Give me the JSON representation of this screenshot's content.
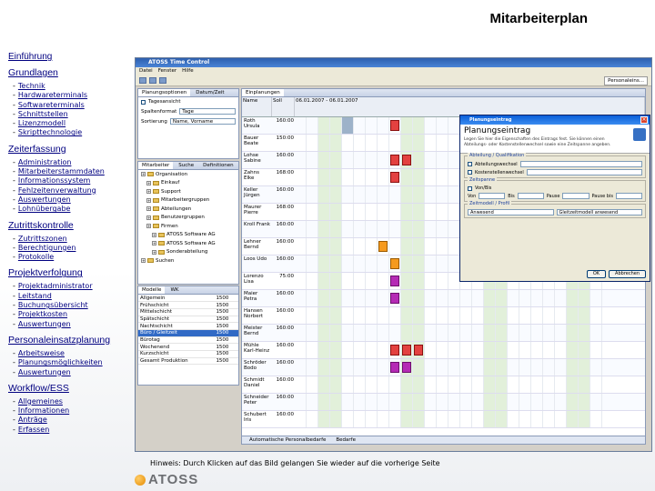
{
  "page": {
    "title": "Mitarbeiterplan",
    "hint": "Hinweis: Durch Klicken auf das Bild gelangen Sie wieder auf die vorherige Seite",
    "logo": "ATOSS"
  },
  "nav": {
    "intro": "Einführung",
    "sections": [
      {
        "title": "Grundlagen",
        "items": [
          "Technik",
          "Hardwareterminals",
          "Softwareterminals",
          "Schnittstellen",
          "Lizenzmodell",
          "Skripttechnologie"
        ]
      },
      {
        "title": "Zeiterfassung",
        "items": [
          "Administration",
          "Mitarbeiterstammdaten",
          "Informationssystem",
          "Fehlzeitenverwaltung",
          "Auswertungen",
          "Lohnübergabe"
        ]
      },
      {
        "title": "Zutrittskontrolle",
        "items": [
          "Zutrittszonen",
          "Berechtigungen",
          "Protokolle"
        ]
      },
      {
        "title": "Projektverfolgung",
        "items": [
          "Projektadministrator",
          "Leitstand",
          "Buchungsübersicht",
          "Projektkosten",
          "Auswertungen"
        ]
      },
      {
        "title": "Personaleinsatzplanung",
        "items": [
          "Arbeitsweise",
          "Planungsmöglichkeiten",
          "Auswertungen"
        ]
      },
      {
        "title": "Workflow/ESS",
        "items": [
          "Allgemeines",
          "Informationen",
          "Anträge",
          "Erfassen"
        ]
      }
    ]
  },
  "app": {
    "title": "ATOSS Time Control",
    "menu": [
      "Datei",
      "Fenster",
      "Hilfe"
    ],
    "perspective": "Personaleins...",
    "options_pane": {
      "tabs": [
        "Planungsoptionen",
        "Datum/Zeit"
      ],
      "tagesansicht": "Tagesansicht",
      "zeitraum_label": "Spaltenformat",
      "zeitraum_value": "Tage",
      "sort_label": "Sortierung",
      "sort_value": "Name, Vorname"
    },
    "tree_pane": {
      "tabs": [
        "Mitarbeiter",
        "Suche",
        "Definitionen"
      ],
      "items": [
        "Organisation",
        "Einkauf",
        "Support",
        "Mitarbeitergruppen",
        "Abteilungen",
        "Benutzergruppen",
        "Firmen",
        "ATOSS Software AG",
        "ATOSS Software AG",
        "Sonderabteilung",
        "Suchen"
      ]
    },
    "models_pane": {
      "tabs": [
        "Modelle",
        "WK"
      ],
      "rows": [
        [
          "Allgemein",
          "1500"
        ],
        [
          "Frühschicht",
          "1500"
        ],
        [
          "Mittelschicht",
          "1500"
        ],
        [
          "Spätschicht",
          "1500"
        ],
        [
          "Nachtschicht",
          "1500"
        ],
        [
          "Büro / Gleitzeit",
          "1500"
        ],
        [
          "Bürotag",
          "1500"
        ],
        [
          "Wochenend",
          "1500"
        ],
        [
          "Kurzschicht",
          "1500"
        ],
        [
          "Gesamt Produktion",
          "1500"
        ]
      ]
    },
    "plan_pane": {
      "tabs": [
        "Einplanungen"
      ],
      "head_name": "Name",
      "head_soll": "Soll",
      "head_range": "06.01.2007 - 06.01.2007",
      "employees": [
        {
          "name": "Roth Ursula",
          "soll": "160:00"
        },
        {
          "name": "Bauer Beate",
          "soll": "150:00"
        },
        {
          "name": "Lohse Sabine",
          "soll": "160:00"
        },
        {
          "name": "Zahns Elke",
          "soll": "168:00"
        },
        {
          "name": "Keller Jürgen",
          "soll": "160:00"
        },
        {
          "name": "Maurer Pierre",
          "soll": "168:00"
        },
        {
          "name": "Kroll Frank",
          "soll": "160:00"
        },
        {
          "name": "Lehner Bernd",
          "soll": "160:00"
        },
        {
          "name": "Loos Udo",
          "soll": "160:00"
        },
        {
          "name": "Lorenzo Lisa",
          "soll": "75:00"
        },
        {
          "name": "Maier Petra",
          "soll": "160:00"
        },
        {
          "name": "Hansen Norbert",
          "soll": "160:00"
        },
        {
          "name": "Meister Bernd",
          "soll": "160:00"
        },
        {
          "name": "Mühle Karl-Heinz",
          "soll": "160:00"
        },
        {
          "name": "Schröder Bodo",
          "soll": "160:00"
        },
        {
          "name": "Schmidt Daniel",
          "soll": "160:00"
        },
        {
          "name": "Schneider Peter",
          "soll": "160:00"
        },
        {
          "name": "Schubert Iris",
          "soll": "160:00"
        }
      ],
      "footer_tab": "Automatische Personalbedarfe",
      "footer_tab2": "Bedarfe"
    },
    "dialog": {
      "title": "Planungseintrag",
      "heading": "Planungseintrag",
      "description": "Legen Sie hier die Eigenschaften des Eintrags fest. Sie können einen Abteilungs- oder Kostenstellenwechsel sowie eine Zeitspanne angeben.",
      "group1": "Abteilung / Qualifikation",
      "g1_row1": "Abteilungswechsel",
      "g1_row2": "Kostenstellenwechsel",
      "group2": "Zeitspanne",
      "g2_row1": "Von/Bis",
      "g2_von": "Von",
      "g2_bis": "Bis",
      "g2_pause": "Pause",
      "g2_pausebis": "Pause bis",
      "group3": "Zeitmodell / Profil",
      "g3_value": "Anwesend",
      "g3_value2": "Gleitzeitmodell anwesend",
      "ok": "OK",
      "cancel": "Abbrechen"
    }
  }
}
